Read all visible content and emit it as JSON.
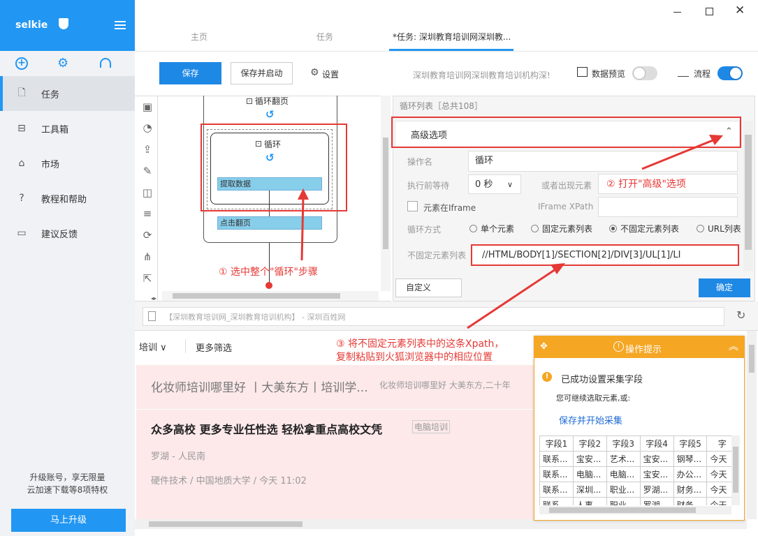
{
  "sidebar": {
    "app_name": "selkie",
    "nav": [
      {
        "label": "任务"
      },
      {
        "label": "工具箱"
      },
      {
        "label": "市场"
      },
      {
        "label": "教程和帮助"
      },
      {
        "label": "建议反馈"
      }
    ],
    "upgrade_text1": "升级账号，享无限量",
    "upgrade_text2": "云加速下载等8项特权",
    "upgrade_button": "马上升级"
  },
  "tabs": [
    "主页",
    "任务",
    "*任务: 深圳教育培训网深圳教..."
  ],
  "toolbar": {
    "save": "保存",
    "save_start": "保存并启动",
    "settings": "设置",
    "task_title": "深圳教育培训网深圳教育培训机构深!",
    "data_preview": "数据预览",
    "flow": "流程"
  },
  "flow": {
    "loop_page": "循环翻页",
    "loop": "循环",
    "extract": "提取数据",
    "click_next": "点击翻页"
  },
  "annotations": {
    "a1": "① 选中整个\"循环\"步骤",
    "a2": "② 打开\"高级\"选项",
    "a3_line1": "③ 将不固定元素列表中的这条Xpath，",
    "a3_line2": "复制粘贴到火狐浏览器中的相应位置"
  },
  "panel": {
    "list_title": "循环列表［总共108］",
    "advanced": "高级选项",
    "op_name_label": "操作名",
    "op_name": "循环",
    "wait_label": "执行前等待",
    "wait_value": "0 秒",
    "or_elem_label": "或者出现元素",
    "iframe_label": "元素在Iframe",
    "iframe_xpath_label": "IFrame XPath",
    "loop_mode_label": "循环方式",
    "modes": [
      "单个元素",
      "固定元素列表",
      "不固定元素列表",
      "URL列表"
    ],
    "unfixed_label": "不固定元素列表",
    "xpath": "//HTML/BODY[1]/SECTION[2]/DIV[3]/UL[1]/LI",
    "custom": "自定义",
    "ok": "确定"
  },
  "browser": {
    "url": "【深圳教育培训网_深圳教育培训机构】 - 深圳百姓网",
    "filter1": "培训",
    "filter2": "更多筛选",
    "item1_title": "化妆师培训哪里好 丨大美东方丨培训学...",
    "item1_desc": "化妆师培训哪里好 大美东方,二十年",
    "item2_title": "众多高校 更多专业任性选 轻松拿重点高校文凭",
    "item2_tag": "电脑培训",
    "item2_loc": "罗湖 - 人民南",
    "item2_meta": "硬件技术 / 中国地质大学 / 今天 11:02"
  },
  "tip": {
    "title": "操作提示",
    "success": "已成功设置采集字段",
    "continue": "您可继续选取元素,或:",
    "link": "保存并开始采集",
    "headers": [
      "字段1",
      "字段2",
      "字段3",
      "字段4",
      "字段5",
      "字"
    ],
    "rows": [
      [
        "联系...",
        "宝安...",
        "艺术...",
        "宝安...",
        "钢琴...",
        "今天"
      ],
      [
        "联系...",
        "电脑...",
        "电脑...",
        "宝安...",
        "办公...",
        "今天"
      ],
      [
        "联系...",
        "深圳...",
        "职业...",
        "罗湖...",
        "财务...",
        "今天"
      ],
      [
        "联系...",
        "人事...",
        "职业...",
        "罗湖...",
        "财务...",
        "今天"
      ]
    ]
  },
  "colors": {
    "accent": "#2196f3",
    "annotation": "#e53935",
    "tip_header": "#f5a623"
  }
}
